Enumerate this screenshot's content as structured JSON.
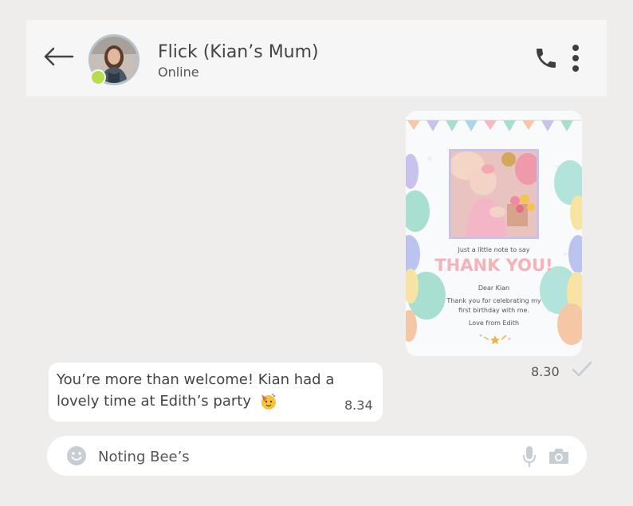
{
  "header": {
    "contact_name": "Flick (Kian’s Mum)",
    "status": "Online",
    "icons": {
      "back": "arrow-left-icon",
      "call": "phone-icon",
      "menu": "more-vertical-icon"
    },
    "online_color": "#b6dd4b"
  },
  "messages": {
    "outgoing_card": {
      "intro": "Just a little note to say",
      "headline": "THANK YOU!",
      "greeting": "Dear Kian",
      "body_line1": "Thank you for celebrating my",
      "body_line2": "first birthday with me.",
      "signoff": "Love from Edith",
      "time": "8.30",
      "status_icon": "check-icon"
    },
    "incoming": {
      "line1": "You’re more than welcome! Kian had a",
      "line2": "lovely time at Edith’s party",
      "emoji": "party-face-icon",
      "time": "8.34"
    }
  },
  "composer": {
    "placeholder": "Noting Bee’s",
    "icons": {
      "emoji": "smiley-icon",
      "mic": "microphone-icon",
      "camera": "camera-icon"
    }
  },
  "colors": {
    "background": "#efedeb",
    "header": "#f6f6f6",
    "bubble": "#ffffff",
    "icon_gray": "#c6cdd5",
    "card_headline": "#f3b3b8"
  }
}
